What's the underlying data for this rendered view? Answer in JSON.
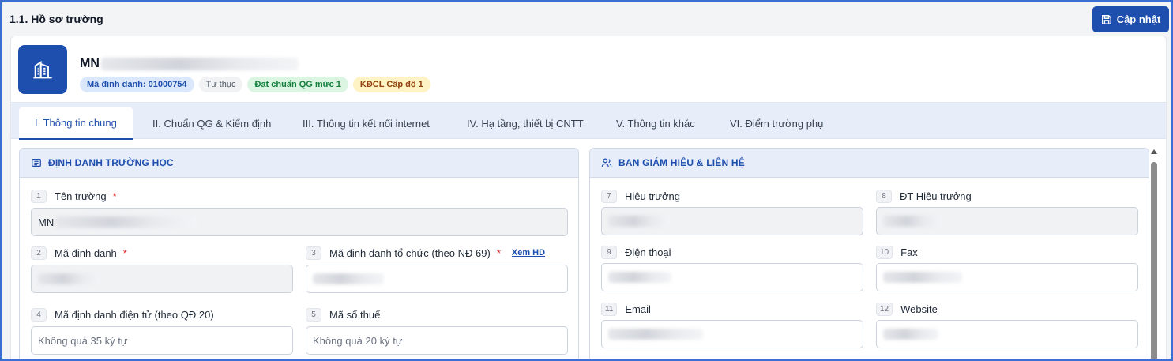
{
  "page": {
    "title": "1.1. Hồ sơ trường",
    "update_button": "Cập nhật"
  },
  "school": {
    "name_prefix": "MN",
    "badges": {
      "ma_dinh_danh": "Mã định danh: 01000754",
      "loai_hinh": "Tư thục",
      "chuan_qg": "Đạt chuẩn QG mức 1",
      "kdcl": "KĐCL Cấp độ 1"
    }
  },
  "tabs": [
    {
      "label": "I. Thông tin chung",
      "active": true
    },
    {
      "label": "II. Chuẩn QG & Kiểm định"
    },
    {
      "label": "III. Thông tin kết nối internet"
    },
    {
      "label": "IV. Hạ tầng, thiết bị CNTT"
    },
    {
      "label": "V. Thông tin khác"
    },
    {
      "label": "VI. Điểm trường phụ"
    }
  ],
  "left_panel": {
    "title": "ĐỊNH DANH TRƯỜNG HỌC",
    "fields": {
      "ten_truong": {
        "num": "1",
        "label": "Tên trường",
        "value": "MN"
      },
      "ma_dinh_danh": {
        "num": "2",
        "label": "Mã định danh"
      },
      "ma_dinh_danh_to_chuc": {
        "num": "3",
        "label": "Mã định danh tổ chức (theo NĐ 69)",
        "link": "Xem HD"
      },
      "ma_dinh_danh_dien_tu": {
        "num": "4",
        "label": "Mã định danh điện tử (theo QĐ 20)",
        "placeholder": "Không quá 35 ký tự"
      },
      "ma_so_thue": {
        "num": "5",
        "label": "Mã số thuế",
        "placeholder": "Không quá 20 ký tự"
      }
    }
  },
  "right_panel": {
    "title": "BAN GIÁM HIỆU & LIÊN HỆ",
    "fields": {
      "hieu_truong": {
        "num": "7",
        "label": "Hiệu trưởng"
      },
      "dt_hieu_truong": {
        "num": "8",
        "label": "ĐT Hiệu trưởng"
      },
      "dien_thoai": {
        "num": "9",
        "label": "Điện thoại"
      },
      "fax": {
        "num": "10",
        "label": "Fax"
      },
      "email": {
        "num": "11",
        "label": "Email"
      },
      "website": {
        "num": "12",
        "label": "Website"
      }
    }
  },
  "colors": {
    "accent": "#1e4fae",
    "frame_border": "#3b6fd6",
    "required": "#dc2626"
  }
}
